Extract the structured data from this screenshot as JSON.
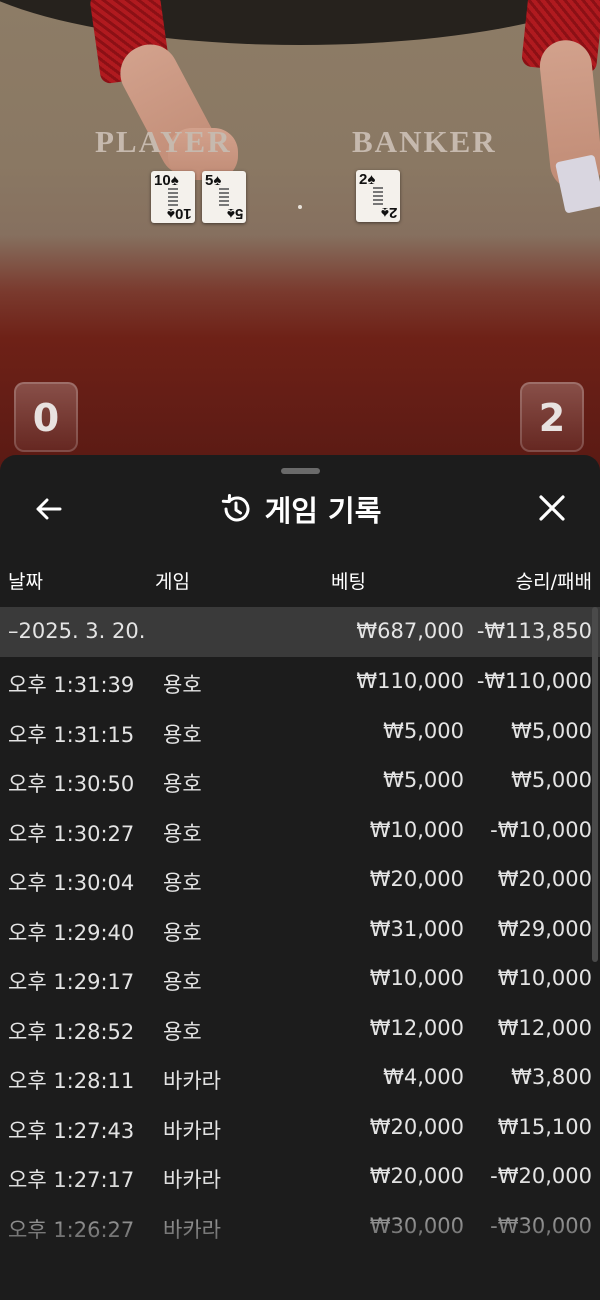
{
  "video": {
    "zones": {
      "player": "PLAYER",
      "banker": "BANKER"
    },
    "player_cards": [
      {
        "rank": "10",
        "suit": "♠"
      },
      {
        "rank": "5",
        "suit": "♠"
      }
    ],
    "banker_cards": [
      {
        "rank": "2",
        "suit": "♠"
      }
    ],
    "scores": {
      "player": "0",
      "banker": "2"
    }
  },
  "sheet": {
    "title": "게임 기록",
    "icons": {
      "back": "arrow-left-icon",
      "history": "history-icon",
      "close": "close-icon"
    },
    "columns": {
      "date": "날짜",
      "game": "게임",
      "bet": "베팅",
      "result": "승리/패배"
    },
    "group": {
      "date": "–2025. 3. 20.",
      "bet": "₩687,000",
      "result": "-₩113,850"
    },
    "rows": [
      {
        "time": "오후 1:31:39",
        "game": "용호",
        "bet": "₩110,000",
        "result": "-₩110,000"
      },
      {
        "time": "오후 1:31:15",
        "game": "용호",
        "bet": "₩5,000",
        "result": "₩5,000"
      },
      {
        "time": "오후 1:30:50",
        "game": "용호",
        "bet": "₩5,000",
        "result": "₩5,000"
      },
      {
        "time": "오후 1:30:27",
        "game": "용호",
        "bet": "₩10,000",
        "result": "-₩10,000"
      },
      {
        "time": "오후 1:30:04",
        "game": "용호",
        "bet": "₩20,000",
        "result": "₩20,000"
      },
      {
        "time": "오후 1:29:40",
        "game": "용호",
        "bet": "₩31,000",
        "result": "₩29,000"
      },
      {
        "time": "오후 1:29:17",
        "game": "용호",
        "bet": "₩10,000",
        "result": "₩10,000"
      },
      {
        "time": "오후 1:28:52",
        "game": "용호",
        "bet": "₩12,000",
        "result": "₩12,000"
      },
      {
        "time": "오후 1:28:11",
        "game": "바카라",
        "bet": "₩4,000",
        "result": "₩3,800"
      },
      {
        "time": "오후 1:27:43",
        "game": "바카라",
        "bet": "₩20,000",
        "result": "₩15,100"
      },
      {
        "time": "오후 1:27:17",
        "game": "바카라",
        "bet": "₩20,000",
        "result": "-₩20,000"
      },
      {
        "time": "오후 1:26:27",
        "game": "바카라",
        "bet": "₩30,000",
        "result": "-₩30,000"
      }
    ]
  },
  "colors": {
    "sheet_bg": "#1c1c1c",
    "group_row_bg": "#3a3a3a",
    "text": "#e4e4e4",
    "table_red": "#6e2117",
    "felt": "#8a7863"
  }
}
